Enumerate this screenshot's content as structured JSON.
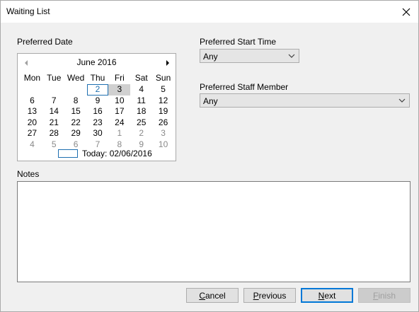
{
  "window": {
    "title": "Waiting List"
  },
  "preferred_date": {
    "label": "Preferred Date",
    "calendar": {
      "month_label": "June 2016",
      "weekdays": [
        "Mon",
        "Tue",
        "Wed",
        "Thu",
        "Fri",
        "Sat",
        "Sun"
      ],
      "today_label": "Today: 02/06/2016",
      "today_day": "2",
      "selected_day": "3",
      "weeks": [
        [
          {
            "d": "",
            "other": false
          },
          {
            "d": "",
            "other": false
          },
          {
            "d": "",
            "other": false
          },
          {
            "d": "2",
            "other": false
          },
          {
            "d": "3",
            "other": false
          },
          {
            "d": "4",
            "other": false
          },
          {
            "d": "5",
            "other": false
          }
        ],
        [
          {
            "d": "6",
            "other": false
          },
          {
            "d": "7",
            "other": false
          },
          {
            "d": "8",
            "other": false
          },
          {
            "d": "9",
            "other": false
          },
          {
            "d": "10",
            "other": false
          },
          {
            "d": "11",
            "other": false
          },
          {
            "d": "12",
            "other": false
          }
        ],
        [
          {
            "d": "13",
            "other": false
          },
          {
            "d": "14",
            "other": false
          },
          {
            "d": "15",
            "other": false
          },
          {
            "d": "16",
            "other": false
          },
          {
            "d": "17",
            "other": false
          },
          {
            "d": "18",
            "other": false
          },
          {
            "d": "19",
            "other": false
          }
        ],
        [
          {
            "d": "20",
            "other": false
          },
          {
            "d": "21",
            "other": false
          },
          {
            "d": "22",
            "other": false
          },
          {
            "d": "23",
            "other": false
          },
          {
            "d": "24",
            "other": false
          },
          {
            "d": "25",
            "other": false
          },
          {
            "d": "26",
            "other": false
          }
        ],
        [
          {
            "d": "27",
            "other": false
          },
          {
            "d": "28",
            "other": false
          },
          {
            "d": "29",
            "other": false
          },
          {
            "d": "30",
            "other": false
          },
          {
            "d": "1",
            "other": true
          },
          {
            "d": "2",
            "other": true
          },
          {
            "d": "3",
            "other": true
          }
        ],
        [
          {
            "d": "4",
            "other": true
          },
          {
            "d": "5",
            "other": true
          },
          {
            "d": "6",
            "other": true
          },
          {
            "d": "7",
            "other": true
          },
          {
            "d": "8",
            "other": true
          },
          {
            "d": "9",
            "other": true
          },
          {
            "d": "10",
            "other": true
          }
        ]
      ]
    }
  },
  "preferred_start_time": {
    "label": "Preferred Start Time",
    "value": "Any"
  },
  "preferred_staff_member": {
    "label": "Preferred Staff Member",
    "value": "Any"
  },
  "notes": {
    "label": "Notes",
    "value": ""
  },
  "buttons": {
    "cancel": {
      "first": "C",
      "rest": "ancel"
    },
    "previous": {
      "first": "P",
      "rest": "revious"
    },
    "next": {
      "first": "N",
      "rest": "ext"
    },
    "finish": {
      "first": "F",
      "rest": "inish"
    }
  },
  "colors": {
    "accent": "#0078d7",
    "today_outline": "#1e6fb0",
    "selected_day_bg": "#d0d0d0",
    "other_month_text": "#8a8a8a"
  },
  "icons": {
    "close": "close-icon",
    "prev_month": "triangle-left-icon",
    "next_month": "triangle-right-icon",
    "dropdown": "chevron-down-icon"
  }
}
